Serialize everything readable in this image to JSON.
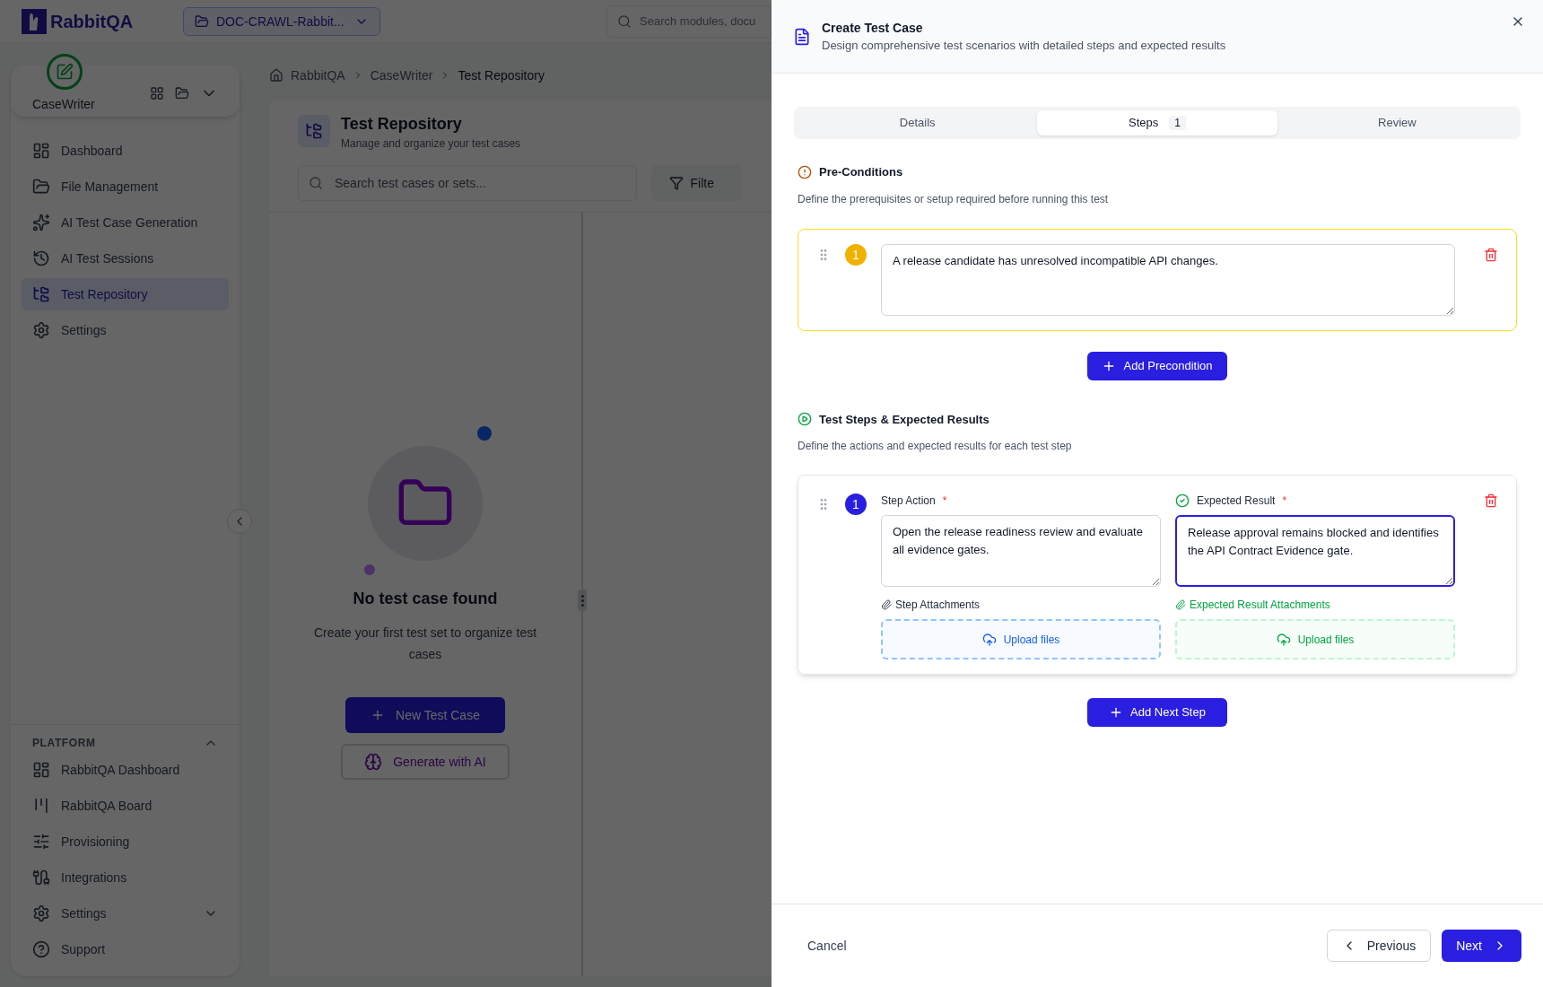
{
  "topbar": {
    "logo_text": "RabbitQA",
    "project": "DOC-CRAWL-Rabbit...",
    "search_placeholder": "Search modules, docu"
  },
  "sidebar": {
    "module": "CaseWriter",
    "items": [
      {
        "label": "Dashboard",
        "selected": false
      },
      {
        "label": "File Management",
        "selected": false
      },
      {
        "label": "AI Test Case Generation",
        "selected": false
      },
      {
        "label": "AI Test Sessions",
        "selected": false
      },
      {
        "label": "Test Repository",
        "selected": true
      },
      {
        "label": "Settings",
        "selected": false
      }
    ],
    "platform": {
      "title": "PLATFORM",
      "expanded": true,
      "items": [
        {
          "label": "RabbitQA Dashboard",
          "kind": "link"
        },
        {
          "label": "RabbitQA Board",
          "kind": "link"
        },
        {
          "label": "Provisioning",
          "kind": "link"
        },
        {
          "label": "Integrations",
          "kind": "link"
        },
        {
          "label": "Settings",
          "kind": "group"
        },
        {
          "label": "Support",
          "kind": "link"
        }
      ]
    }
  },
  "breadcrumb": [
    "RabbitQA",
    "CaseWriter",
    "Test Repository"
  ],
  "repository": {
    "title": "Test Repository",
    "subtitle": "Manage and organize your test cases",
    "search_placeholder": "Search test cases or sets...",
    "filter": "Filte",
    "empty": {
      "title": "No test case found",
      "text": "Create your first test set to organize test cases",
      "new_button": "New Test Case",
      "ai_button": "Generate with AI"
    }
  },
  "dialog": {
    "title": "Create Test Case",
    "subtitle": "Design comprehensive test scenarios with detailed steps and expected results",
    "tabs": [
      {
        "label": "Details",
        "selected": false
      },
      {
        "label": "Steps",
        "badge": "1",
        "selected": true
      },
      {
        "label": "Review",
        "selected": false
      }
    ],
    "preconditions": {
      "title": "Pre-Conditions",
      "description": "Define the prerequisites or setup required before running this test",
      "items": [
        {
          "number": "1",
          "text": "A release candidate has unresolved incompatible API changes."
        }
      ],
      "add_button": "Add Precondition"
    },
    "steps": {
      "title": "Test Steps & Expected Results",
      "description": "Define the actions and expected results for each test step",
      "items": [
        {
          "number": "1",
          "action_label": "Step Action",
          "action_required": "*",
          "action_text": "Open the release readiness review and evaluate all evidence gates.",
          "expected_label": "Expected Result",
          "expected_required": "*",
          "expected_text": "Release approval remains blocked and identifies the API Contract Evidence gate.",
          "expected_focused": true,
          "step_attachments": "Step Attachments",
          "step_upload": "Upload files",
          "expected_attachments": "Expected Result Attachments",
          "expected_upload": "Upload files"
        }
      ],
      "add_button": "Add Next Step"
    },
    "footer": {
      "cancel": "Cancel",
      "previous": "Previous",
      "next": "Next"
    }
  }
}
